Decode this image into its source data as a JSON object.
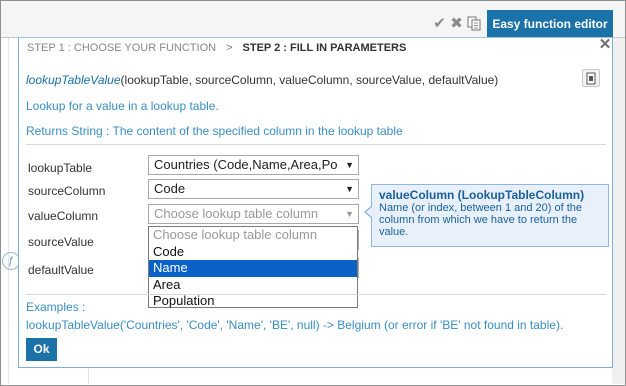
{
  "toolbar": {
    "icons": [
      "check-icon",
      "x-icon",
      "copy-icon"
    ],
    "easy_editor_button": "Easy function editor"
  },
  "background": {
    "circle_glyph": "ƒ"
  },
  "dialog": {
    "steps": {
      "step1": "STEP 1 : CHOOSE YOUR FUNCTION",
      "separator": ">",
      "step2": "STEP 2 : FILL IN PARAMETERS"
    },
    "signature": {
      "function_name": "lookupTableValue",
      "params": "(lookupTable, sourceColumn, valueColumn, sourceValue, defaultValue)"
    },
    "description": "Lookup for a value in a lookup table.",
    "returns": "Returns String : The content of the specified column in the lookup table",
    "params": {
      "lookupTable": {
        "label": "lookupTable",
        "value": "Countries (Code,Name,Area,Po"
      },
      "sourceColumn": {
        "label": "sourceColumn",
        "value": "Code"
      },
      "valueColumn": {
        "label": "valueColumn",
        "placeholder": "Choose lookup table column"
      },
      "sourceValue": {
        "label": "sourceValue",
        "value": ""
      },
      "defaultValue": {
        "label": "defaultValue",
        "value": ""
      }
    },
    "dropdown": {
      "options": [
        "Choose lookup table column",
        "Code",
        "Name",
        "Area",
        "Population"
      ],
      "highlighted": "Name"
    },
    "tooltip": {
      "title": "valueColumn (LookupTableColumn)",
      "body": "Name (or index, between 1 and 20) of the column from which we have to return the value."
    },
    "examples_label": "Examples :",
    "examples_text": "lookupTableValue('Countries', 'Code', 'Name', 'BE', null) -> Belgium (or error if 'BE' not found in table).",
    "ok_label": "Ok"
  },
  "colors": {
    "accent": "#1a72a8",
    "link_text": "#3a8ec3",
    "selection": "#0a62c9",
    "tooltip_bg": "#e8f1fb"
  }
}
